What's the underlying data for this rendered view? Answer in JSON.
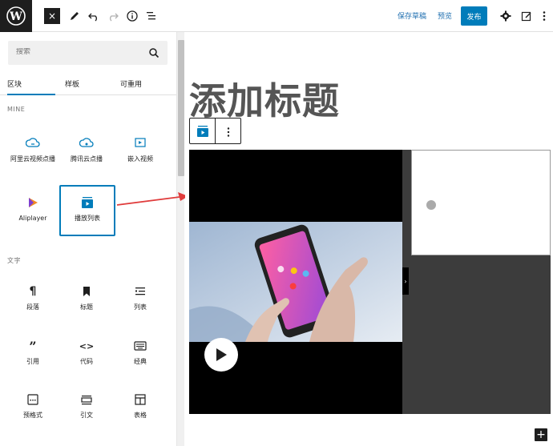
{
  "topbar": {
    "close_label": "×",
    "save_draft": "保存草稿",
    "preview": "预览",
    "publish": "发布"
  },
  "sidebar": {
    "search_placeholder": "搜索",
    "tabs": [
      {
        "label": "区块",
        "active": true
      },
      {
        "label": "样板",
        "active": false
      },
      {
        "label": "可重用",
        "active": false
      }
    ],
    "sections": {
      "mine": "MINE",
      "text": "文字"
    },
    "mine_blocks": [
      {
        "label": "阿里云视频点播",
        "icon": "cloud-icon"
      },
      {
        "label": "腾讯云点播",
        "icon": "cloud-icon"
      },
      {
        "label": "嵌入视频",
        "icon": "video-embed-icon"
      },
      {
        "label": "Aliplayer",
        "icon": "play-triangle-icon"
      },
      {
        "label": "播放列表",
        "icon": "playlist-icon"
      }
    ],
    "text_blocks": [
      {
        "label": "段落",
        "icon": "paragraph-icon"
      },
      {
        "label": "标题",
        "icon": "bookmark-icon"
      },
      {
        "label": "列表",
        "icon": "list-icon"
      },
      {
        "label": "引用",
        "icon": "quote-icon"
      },
      {
        "label": "代码",
        "icon": "code-icon"
      },
      {
        "label": "经典",
        "icon": "keyboard-icon"
      },
      {
        "label": "预格式",
        "icon": "preformatted-icon"
      },
      {
        "label": "引文",
        "icon": "pullquote-icon"
      },
      {
        "label": "表格",
        "icon": "table-icon"
      }
    ]
  },
  "editor": {
    "title": "添加标题",
    "add_block": "+"
  },
  "colors": {
    "accent": "#007cba",
    "arrow": "#e03c3c"
  }
}
